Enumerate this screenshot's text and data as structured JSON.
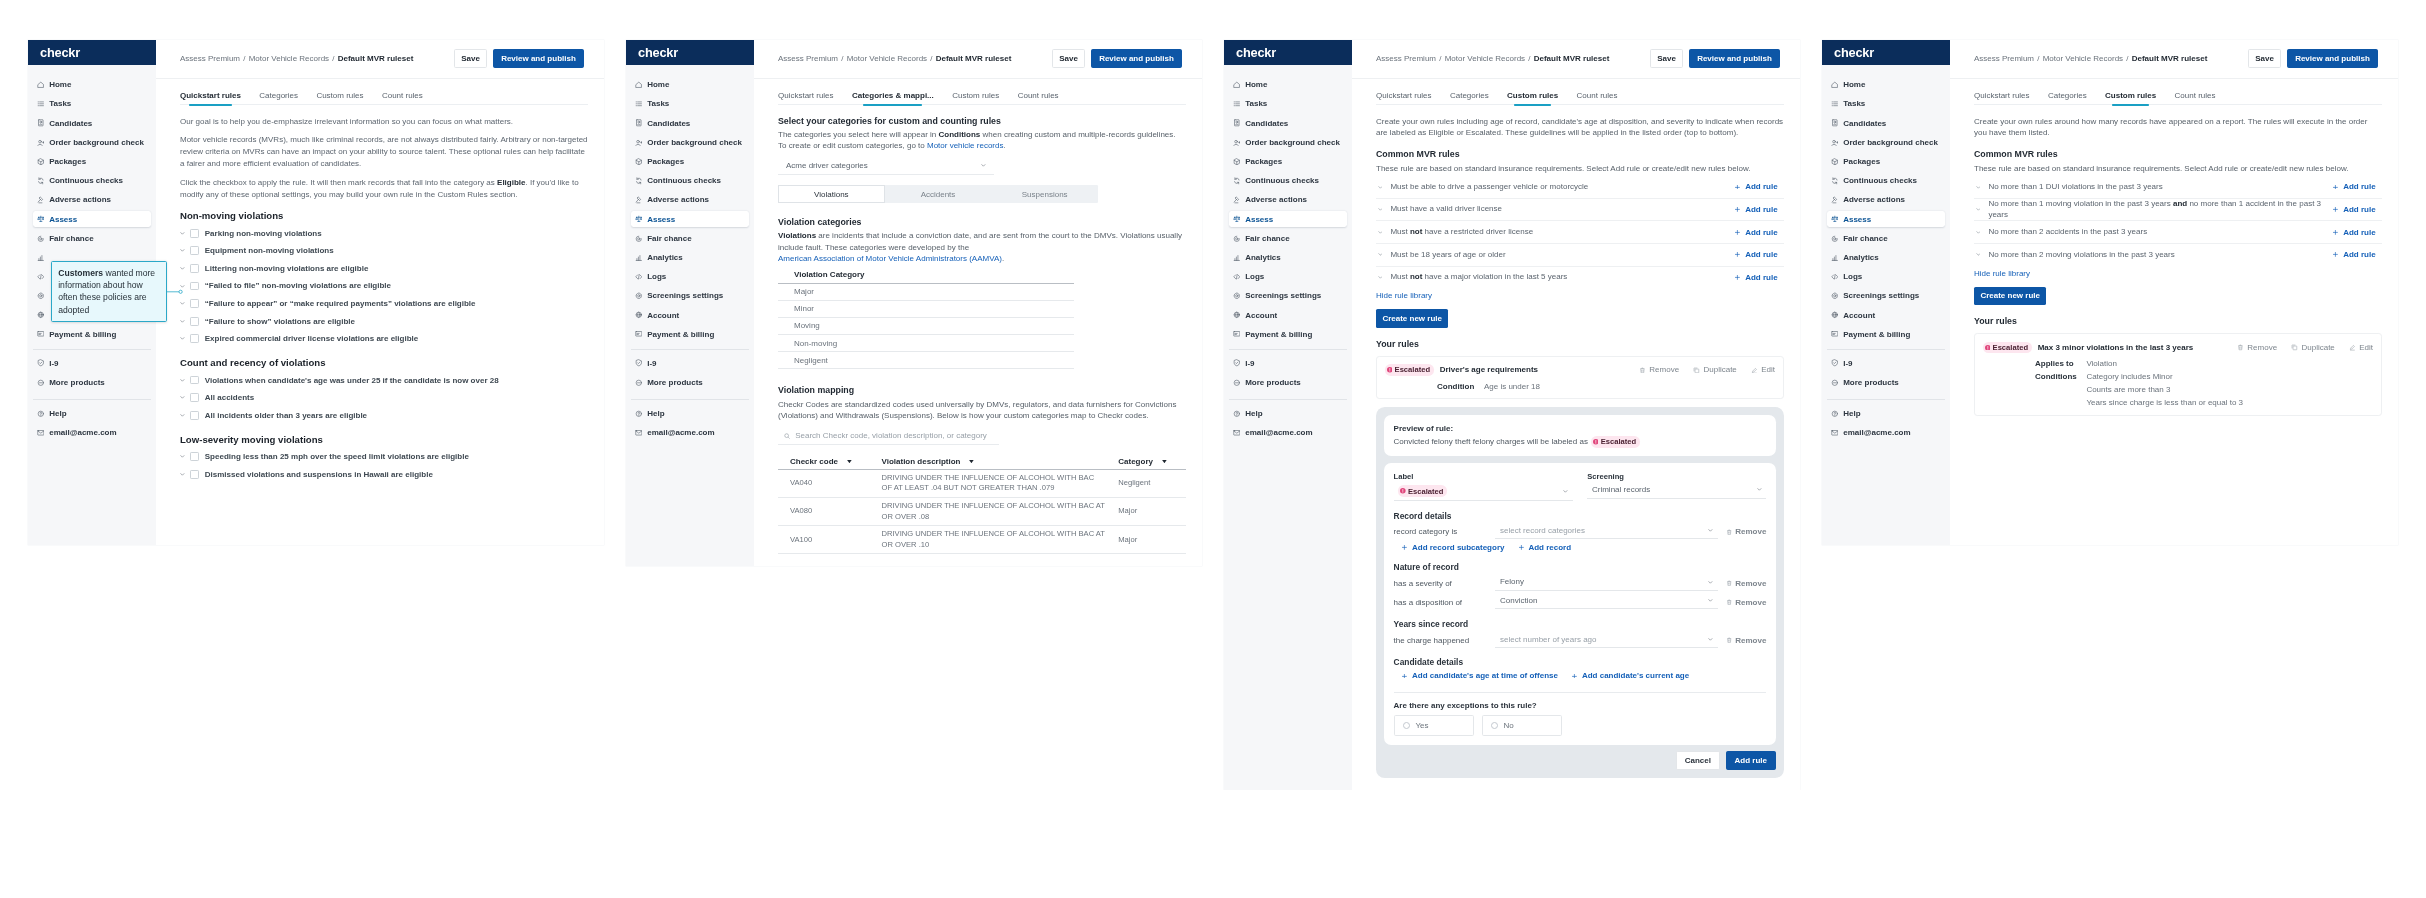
{
  "screens": [
    {
      "sidebar": {
        "logo": "checkr",
        "groups": [
          [
            {
              "label": "Home",
              "selected": false
            },
            {
              "label": "Tasks",
              "selected": false
            },
            {
              "label": "Candidates",
              "selected": false
            },
            {
              "label": "Order background check",
              "selected": false
            },
            {
              "label": "Packages",
              "selected": false
            },
            {
              "label": "Continuous checks",
              "selected": false
            },
            {
              "label": "Adverse actions",
              "selected": false
            },
            {
              "label": "Assess",
              "selected": true
            },
            {
              "label": "Fair chance",
              "selected": false
            },
            {
              "selected": false
            },
            {
              "selected": false
            },
            {
              "selected": false
            },
            {
              "selected": false
            },
            {
              "label": "Payment & billing",
              "selected": false
            }
          ],
          [
            {
              "label": "I-9",
              "selected": false
            },
            {
              "label": "More products",
              "selected": false
            }
          ],
          [
            {
              "label": "Help",
              "selected": false
            },
            {
              "label": "email@acme.com",
              "selected": false
            }
          ]
        ]
      },
      "breadcrumb": {
        "separator": "/",
        "items": [
          "Assess Premium",
          "Motor Vehicle Records",
          "Default MVR ruleset"
        ]
      },
      "actions": [
        {
          "label": "Save",
          "kind": "secondary"
        },
        {
          "label": "Review and publish",
          "kind": "primary"
        }
      ],
      "tabs": [
        {
          "label": "Quickstart rules",
          "selected": true
        },
        {
          "label": "Categories",
          "selected": false
        },
        {
          "label": "Custom rules",
          "selected": false
        },
        {
          "label": "Count rules",
          "selected": false
        }
      ],
      "callout": {
        "text": "**Customers** wanted more information about how often these policies are adopted"
      },
      "content": {
        "kind": "quickstart",
        "paragraphs": [
          "Our goal is to help you de-emphasize irrelevant information so you can focus on what matters.",
          "Motor vehicle records (MVRs), much like criminal records, are not always distributed fairly. Arbitrary or non-targeted review criteria on MVRs can have an impact on your ability to source talent. These optional rules can help facilitate a fairer and more efficient evaluation of candidates.",
          "Click the checkbox to apply the rule. It will then mark records that fall into the category as **Eligible**. If you'd like to modify any of these optional settings, you may build your own rule in the Custom Rules section."
        ],
        "sections": [
          {
            "title": "Non-moving violations",
            "rules": [
              {
                "label": "Parking non-moving violations",
                "checked": false
              },
              {
                "label": "Equipment non-moving violations",
                "checked": false
              },
              {
                "label": "Littering non-moving violations are eligible",
                "checked": false
              },
              {
                "label": "“Failed to file” non-moving violations are eligible",
                "checked": false
              },
              {
                "label": "“Failure to appear” or “make required payments” violations are eligible",
                "checked": false
              },
              {
                "label": "“Failure to show” violations are eligible",
                "checked": false
              },
              {
                "label": "Expired commercial driver license violations are eligible",
                "checked": false
              }
            ]
          },
          {
            "title": "Count and recency of violations",
            "rules": [
              {
                "label": "Violations when candidate's age was under 25 if the candidate is now over 28",
                "checked": false
              },
              {
                "label": "All accidents",
                "checked": false
              },
              {
                "label": "All incidents older than 3 years are eligible",
                "checked": false
              }
            ]
          },
          {
            "title": "Low-severity moving violations",
            "rules": [
              {
                "label": "Speeding less than 25 mph over the speed limit violations are eligible",
                "checked": false
              },
              {
                "label": "Dismissed violations and suspensions in Hawaii are eligible",
                "checked": false
              }
            ]
          }
        ]
      }
    },
    {
      "sidebar": {
        "logo": "checkr",
        "groups": [
          [
            {
              "label": "Home",
              "selected": false
            },
            {
              "label": "Tasks",
              "selected": false
            },
            {
              "label": "Candidates",
              "selected": false
            },
            {
              "label": "Order background check",
              "selected": false
            },
            {
              "label": "Packages",
              "selected": false
            },
            {
              "label": "Continuous checks",
              "selected": false
            },
            {
              "label": "Adverse actions",
              "selected": false
            },
            {
              "label": "Assess",
              "selected": true
            },
            {
              "label": "Fair chance",
              "selected": false
            },
            {
              "label": "Analytics",
              "selected": false
            },
            {
              "label": "Logs",
              "selected": false
            },
            {
              "label": "Screenings settings",
              "selected": false
            },
            {
              "label": "Account",
              "selected": false
            },
            {
              "label": "Payment & billing",
              "selected": false
            }
          ],
          [
            {
              "label": "I-9",
              "selected": false
            },
            {
              "label": "More products",
              "selected": false
            }
          ],
          [
            {
              "label": "Help",
              "selected": false
            },
            {
              "label": "email@acme.com",
              "selected": false
            }
          ]
        ]
      },
      "breadcrumb": {
        "separator": "/",
        "items": [
          "Assess Premium",
          "Motor Vehicle Records",
          "Default MVR ruleset"
        ]
      },
      "actions": [
        {
          "label": "Save",
          "kind": "secondary"
        },
        {
          "label": "Review and publish",
          "kind": "primary"
        }
      ],
      "tabs": [
        {
          "label": "Quickstart rules",
          "selected": false
        },
        {
          "label": "Categories & mappi...",
          "selected": true
        },
        {
          "label": "Custom rules",
          "selected": false
        },
        {
          "label": "Count rules",
          "selected": false
        }
      ],
      "content": {
        "kind": "categories",
        "title": "Select your categories for custom and counting rules",
        "intro": {
          "text": "The categories you select here will appear in **Conditions** when creating custom and multiple-records guidelines. To create or edit custom categories, go to ",
          "link": "Motor vehicle records",
          "after": "."
        },
        "select": {
          "value": "Acme driver categories"
        },
        "segments": [
          {
            "label": "Violations",
            "selected": true
          },
          {
            "label": "Accidents",
            "selected": false
          },
          {
            "label": "Suspensions",
            "selected": false
          }
        ],
        "categories": {
          "title": "Violation categories",
          "intro": {
            "text": "**Violations** are incidents that include a conviction date, and are sent from the court to the DMVs. Violations usually include fault. These categories were developed by the ",
            "link": "American Association of Motor Vehicle Administrators (AAMVA)",
            "after": "."
          },
          "column": "Violation Category",
          "rows": [
            "Major",
            "Minor",
            "Moving",
            "Non-moving",
            "Negligent"
          ]
        },
        "mapping": {
          "title": "Violation mapping",
          "text": "Checkr Codes are standardized codes used universally by DMVs, regulators, and data furnishers for Convictions (Violations) and Withdrawals (Suspensions). Below is how your custom categories map to Checkr codes.",
          "search": {
            "placeholder": "Search Checkr code, violation description, or category"
          },
          "columns": [
            "Checkr code",
            "Violation description",
            "Category"
          ],
          "rows": [
            [
              "VA040",
              "DRIVING UNDER THE INFLUENCE OF ALCOHOL WITH BAC OF AT LEAST .04 BUT NOT GREATER THAN .079",
              "Negligent"
            ],
            [
              "VA080",
              "DRIVING UNDER THE INFLUENCE OF ALCOHOL WITH BAC AT OR OVER .08",
              "Major"
            ],
            [
              "VA100",
              "DRIVING UNDER THE INFLUENCE OF ALCOHOL WITH BAC AT OR OVER .10",
              "Major"
            ]
          ]
        }
      }
    },
    {
      "sidebar": {
        "logo": "checkr",
        "groups": [
          [
            {
              "label": "Home",
              "selected": false
            },
            {
              "label": "Tasks",
              "selected": false
            },
            {
              "label": "Candidates",
              "selected": false
            },
            {
              "label": "Order background check",
              "selected": false
            },
            {
              "label": "Packages",
              "selected": false
            },
            {
              "label": "Continuous checks",
              "selected": false
            },
            {
              "label": "Adverse actions",
              "selected": false
            },
            {
              "label": "Assess",
              "selected": true
            },
            {
              "label": "Fair chance",
              "selected": false
            },
            {
              "label": "Analytics",
              "selected": false
            },
            {
              "label": "Logs",
              "selected": false
            },
            {
              "label": "Screenings settings",
              "selected": false
            },
            {
              "label": "Account",
              "selected": false
            },
            {
              "label": "Payment & billing",
              "selected": false
            }
          ],
          [
            {
              "label": "I-9",
              "selected": false
            },
            {
              "label": "More products",
              "selected": false
            }
          ],
          [
            {
              "label": "Help",
              "selected": false
            },
            {
              "label": "email@acme.com",
              "selected": false
            }
          ]
        ]
      },
      "breadcrumb": {
        "separator": "/",
        "items": [
          "Assess Premium",
          "Motor Vehicle Records",
          "Default MVR ruleset"
        ]
      },
      "actions": [
        {
          "label": "Save",
          "kind": "secondary"
        },
        {
          "label": "Review and publish",
          "kind": "primary"
        }
      ],
      "tabs": [
        {
          "label": "Quickstart rules",
          "selected": false
        },
        {
          "label": "Categories",
          "selected": false
        },
        {
          "label": "Custom rules",
          "selected": true
        },
        {
          "label": "Count rules",
          "selected": false
        }
      ],
      "content": {
        "kind": "custom",
        "intro": "Create your own rules including age of record, candidate's age at disposition, and severity to indicate when records are labeled as Eligible or Escalated. These guidelines will be applied in the listed order (top to bottom).",
        "common": {
          "title": "Common MVR rules",
          "text": "These rule are based on standard insurance requirements. Select Add rule or create/edit new rules below.",
          "rules": [
            {
              "label": "Must be able to drive a passenger vehicle or motorcycle",
              "action": "Add rule"
            },
            {
              "label": "Must have a valid driver license",
              "action": "Add rule"
            },
            {
              "label": "Must **not** have a restricted driver license",
              "action": "Add rule"
            },
            {
              "label": "Must be 18 years of age or older",
              "action": "Add rule"
            },
            {
              "label": "Must **not** have a major violation in the last 5 years",
              "action": "Add rule"
            }
          ]
        },
        "hide_link": "Hide rule library",
        "create_button": "Create new rule",
        "yours": {
          "title": "Your rules",
          "rules": [
            {
              "badge": {
                "label": "Escalated",
                "kind": "escalated"
              },
              "title": "Driver's age requirements",
              "actions": [
                "Remove",
                "Duplicate",
                "Edit"
              ],
              "details": [
                {
                  "label": "Condition",
                  "values": [
                    "Age is under 18"
                  ]
                }
              ]
            }
          ]
        },
        "editor": {
          "preview": {
            "title": "Preview of rule:",
            "text": "Convicted felony theft felony charges will be labeled as",
            "badge": {
              "label": "Escalated",
              "kind": "escalated"
            }
          },
          "label": {
            "title": "Label",
            "badge": {
              "label": "Escalated",
              "kind": "escalated"
            }
          },
          "screening": {
            "title": "Screening",
            "value": "Criminal records"
          },
          "sections": [
            {
              "title": "Record details",
              "rows": [
                {
                  "label": "record category is",
                  "placeholder": "select record categories",
                  "remove": "Remove"
                }
              ],
              "links": [
                "Add record subcategory",
                "Add record"
              ]
            },
            {
              "title": "Nature of record",
              "rows": [
                {
                  "label": "has a severity of",
                  "value": "Felony",
                  "remove": "Remove"
                },
                {
                  "label": "has a disposition of",
                  "value": "Conviction",
                  "remove": "Remove"
                }
              ]
            },
            {
              "title": "Years since record",
              "rows": [
                {
                  "label": "the charge happened",
                  "placeholder": "select number of years ago",
                  "remove": "Remove"
                }
              ]
            },
            {
              "title": "Candidate details",
              "links": [
                "Add candidate's age at time of offense",
                "Add candidate's current age"
              ]
            }
          ],
          "exceptions": {
            "question": "Are there any exceptions to this rule?",
            "options": [
              {
                "label": "Yes",
                "selected": false
              },
              {
                "label": "No",
                "selected": false
              }
            ]
          },
          "buttons": [
            {
              "label": "Cancel",
              "kind": "secondary"
            },
            {
              "label": "Add rule",
              "kind": "primary"
            }
          ]
        }
      }
    },
    {
      "sidebar": {
        "logo": "checkr",
        "groups": [
          [
            {
              "label": "Home",
              "selected": false
            },
            {
              "label": "Tasks",
              "selected": false
            },
            {
              "label": "Candidates",
              "selected": false
            },
            {
              "label": "Order background check",
              "selected": false
            },
            {
              "label": "Packages",
              "selected": false
            },
            {
              "label": "Continuous checks",
              "selected": false
            },
            {
              "label": "Adverse actions",
              "selected": false
            },
            {
              "label": "Assess",
              "selected": true
            },
            {
              "label": "Fair chance",
              "selected": false
            },
            {
              "label": "Analytics",
              "selected": false
            },
            {
              "label": "Logs",
              "selected": false
            },
            {
              "label": "Screenings settings",
              "selected": false
            },
            {
              "label": "Account",
              "selected": false
            },
            {
              "label": "Payment & billing",
              "selected": false
            }
          ],
          [
            {
              "label": "I-9",
              "selected": false
            },
            {
              "label": "More products",
              "selected": false
            }
          ],
          [
            {
              "label": "Help",
              "selected": false
            },
            {
              "label": "email@acme.com",
              "selected": false
            }
          ]
        ]
      },
      "breadcrumb": {
        "separator": "/",
        "items": [
          "Assess Premium",
          "Motor Vehicle Records",
          "Default MVR ruleset"
        ]
      },
      "actions": [
        {
          "label": "Save",
          "kind": "secondary"
        },
        {
          "label": "Review and publish",
          "kind": "primary"
        }
      ],
      "tabs": [
        {
          "label": "Quickstart rules",
          "selected": false
        },
        {
          "label": "Categories",
          "selected": false
        },
        {
          "label": "Custom rules",
          "selected": true
        },
        {
          "label": "Count rules",
          "selected": false
        }
      ],
      "content": {
        "kind": "custom",
        "intro": "Create your own rules around how many records have appeared on a report. The rules will execute in the order you have them listed.",
        "common": {
          "title": "Common MVR rules",
          "text": "These rule are based on standard insurance requirements. Select Add rule or create/edit new rules below.",
          "rules": [
            {
              "label": "No more than 1 DUI violations in the past 3 years",
              "action": "Add rule"
            },
            {
              "label": "No more than 1 moving violation in the past 3 years **and** no more than 1 accident in the past 3 years",
              "action": "Add rule"
            },
            {
              "label": "No more than 2 accidents in the past 3 years",
              "action": "Add rule"
            },
            {
              "label": "No more than 2 moving violations in the past 3 years",
              "action": "Add rule"
            }
          ]
        },
        "hide_link": "Hide rule library",
        "create_button": "Create new rule",
        "yours": {
          "title": "Your rules",
          "rules": [
            {
              "badge": {
                "label": "Escalated",
                "kind": "escalated"
              },
              "title": "Max 3 minor violations in the last 3 years",
              "actions": [
                "Remove",
                "Duplicate",
                "Edit"
              ],
              "details": [
                {
                  "label": "Applies to",
                  "values": [
                    "Violation"
                  ]
                },
                {
                  "label": "Conditions",
                  "values": [
                    "Category includes Minor",
                    "Counts are more than 3",
                    "Years since charge is less than or equal to 3"
                  ]
                }
              ]
            }
          ]
        }
      }
    }
  ]
}
